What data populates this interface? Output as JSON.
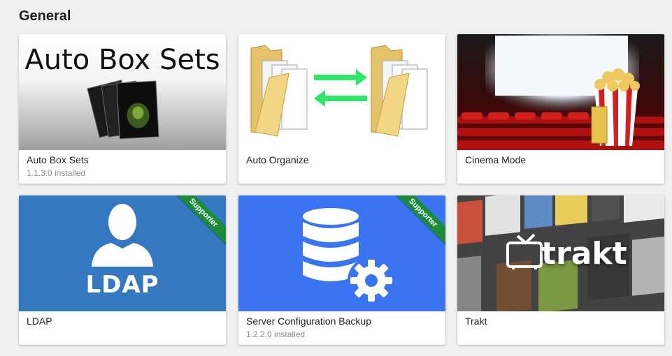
{
  "section": {
    "title": "General"
  },
  "colors": {
    "supporter_ribbon": "#1c8c3c",
    "ldap_bg": "#3478bf",
    "backup_bg": "#3b74f0"
  },
  "cards": [
    {
      "title": "Auto Box Sets",
      "subtitle": "1.1.3.0 installed",
      "thumb_text": "Auto Box Sets",
      "icon": "dvd-stack-icon"
    },
    {
      "title": "Auto Organize",
      "subtitle": "",
      "icon": "folder-sync-icon"
    },
    {
      "title": "Cinema Mode",
      "subtitle": "",
      "icon": "cinema-theater-icon"
    },
    {
      "title": "LDAP",
      "subtitle": "",
      "thumb_text": "LDAP",
      "badge": "Supporter",
      "icon": "user-silhouette-icon"
    },
    {
      "title": "Server Configuration Backup",
      "subtitle": "1.2.2.0 installed",
      "badge": "Supporter",
      "icon": "database-gear-icon"
    },
    {
      "title": "Trakt",
      "subtitle": "",
      "thumb_text": "trakt",
      "icon": "tv-icon"
    }
  ]
}
